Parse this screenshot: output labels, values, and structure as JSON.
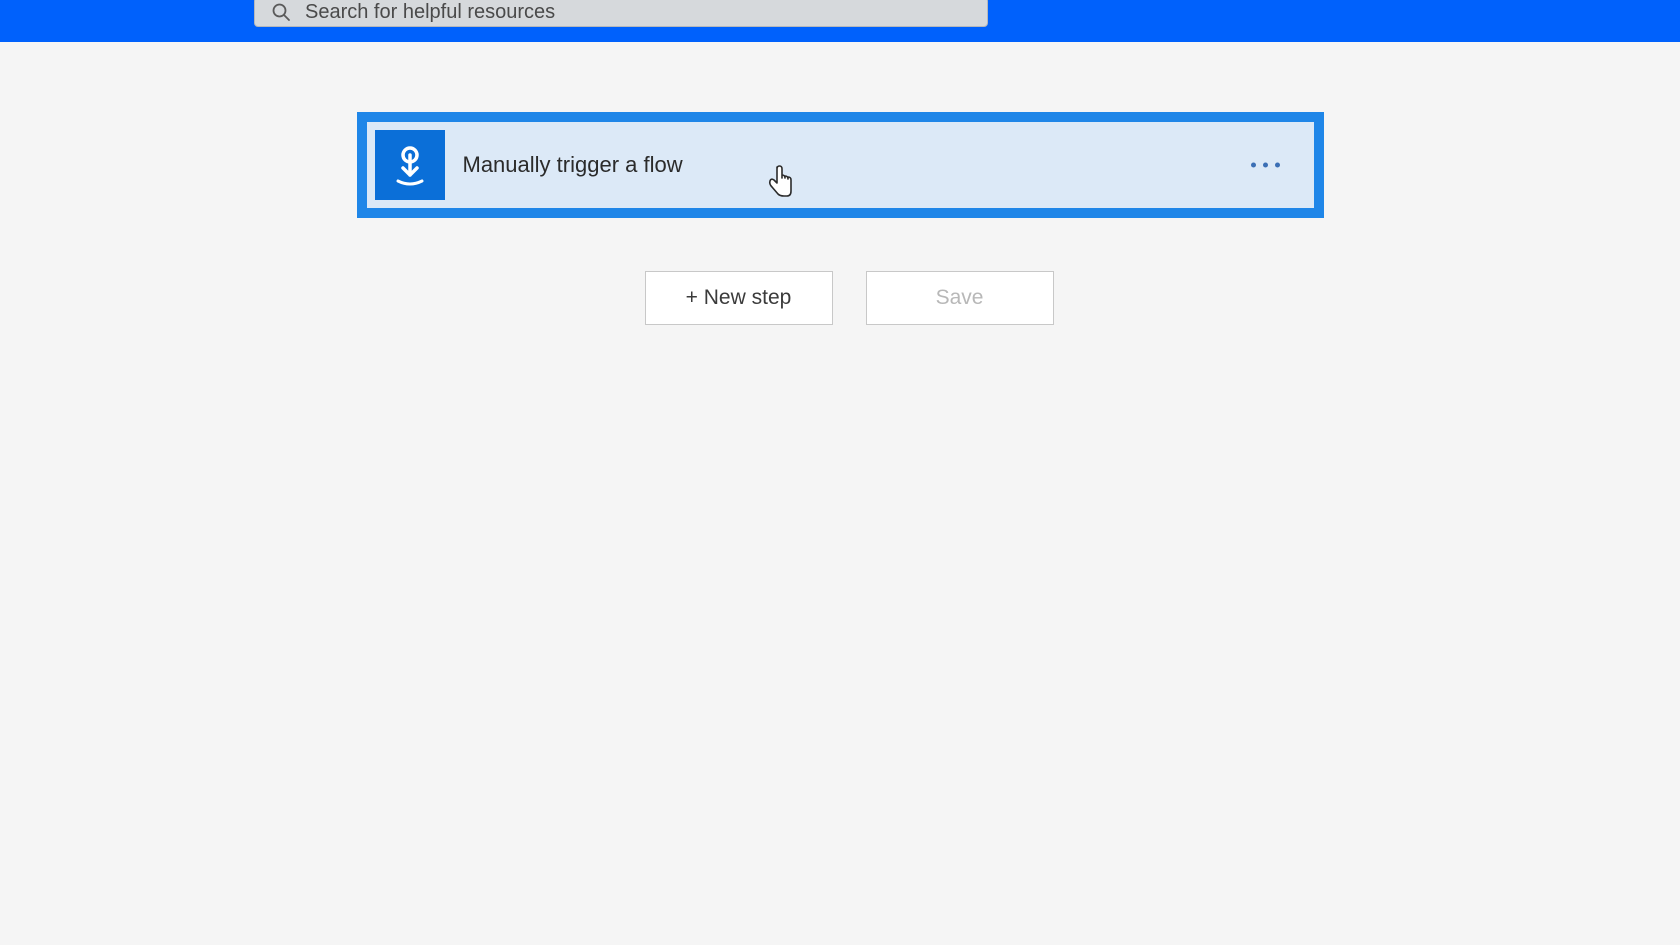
{
  "header": {
    "search_placeholder": "Search for helpful resources"
  },
  "trigger": {
    "title": "Manually trigger a flow"
  },
  "actions": {
    "new_step_label": "+ New step",
    "save_label": "Save"
  }
}
